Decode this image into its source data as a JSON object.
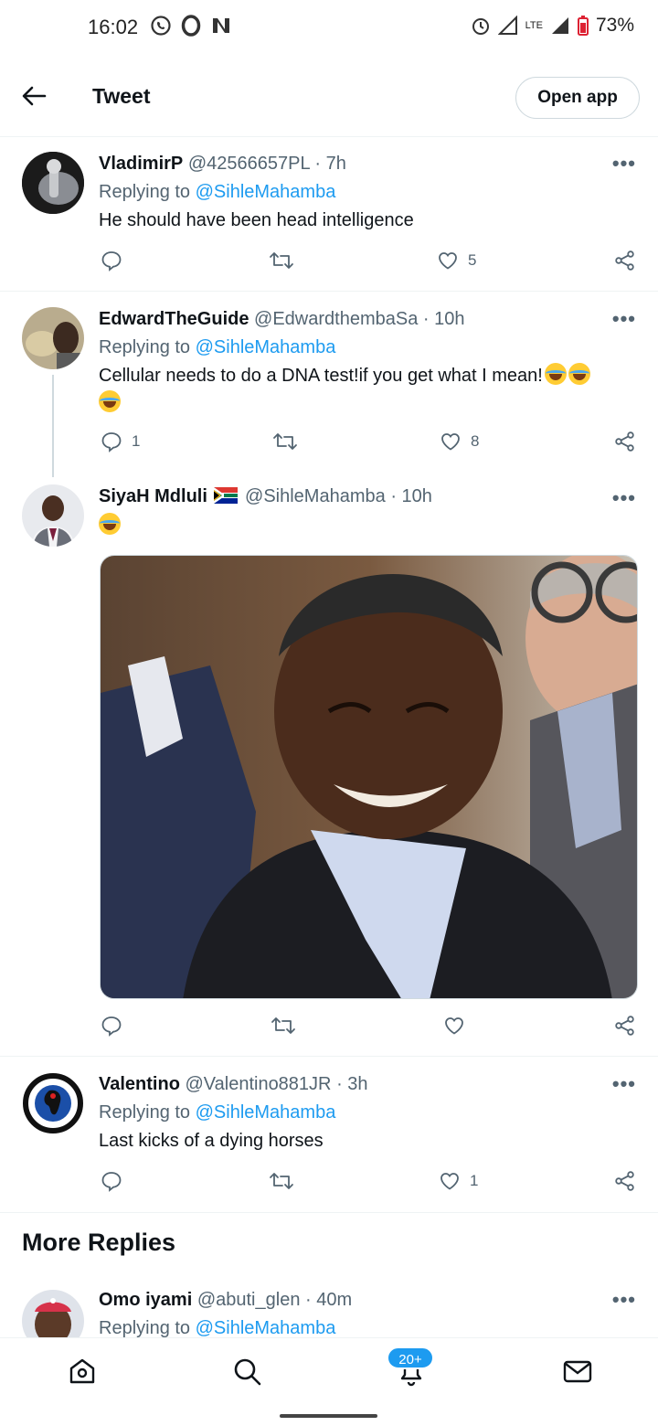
{
  "status_bar": {
    "time": "16:02",
    "network": "LTE",
    "battery": "73%",
    "icons": [
      "whatsapp-icon",
      "opera-icon",
      "news-icon",
      "alarm-icon",
      "signal-icon",
      "battery-icon"
    ]
  },
  "header": {
    "title": "Tweet",
    "open_app_label": "Open app"
  },
  "tweets": [
    {
      "name": "VladimirP",
      "handle": "@42566657PL",
      "time": "· 7h",
      "replying_prefix": "Replying to",
      "replying_to": "@SihleMahamba",
      "text": "He should have been head intelligence",
      "replies": "",
      "retweets": "",
      "likes": "5"
    },
    {
      "name": "EdwardTheGuide",
      "handle": "@EdwardthembaSa",
      "time": "· 10h",
      "replying_prefix": "Replying to",
      "replying_to": "@SihleMahamba",
      "text": "Cellular needs to do a DNA test!if you get what I mean!",
      "replies": "1",
      "retweets": "",
      "likes": "8"
    },
    {
      "name": "SiyaH Mdluli",
      "handle": "@SihleMahamba",
      "time": "· 10h",
      "text": "",
      "replies": "",
      "retweets": "",
      "likes": ""
    },
    {
      "name": "Valentino",
      "handle": "@Valentino881JR",
      "time": "· 3h",
      "replying_prefix": "Replying to",
      "replying_to": "@SihleMahamba",
      "text": "Last kicks of a dying horses",
      "replies": "",
      "retweets": "",
      "likes": "1"
    },
    {
      "name": "Omo iyami",
      "handle": "@abuti_glen",
      "time": "· 40m",
      "replying_prefix": "Replying to",
      "replying_to": "@SihleMahamba"
    }
  ],
  "more_replies_title": "More Replies",
  "bottom_nav": {
    "notifications_badge": "20+"
  },
  "colors": {
    "accent": "#1d9bf0",
    "text": "#0f1419",
    "muted": "#536471",
    "divider": "#eff3f4"
  }
}
